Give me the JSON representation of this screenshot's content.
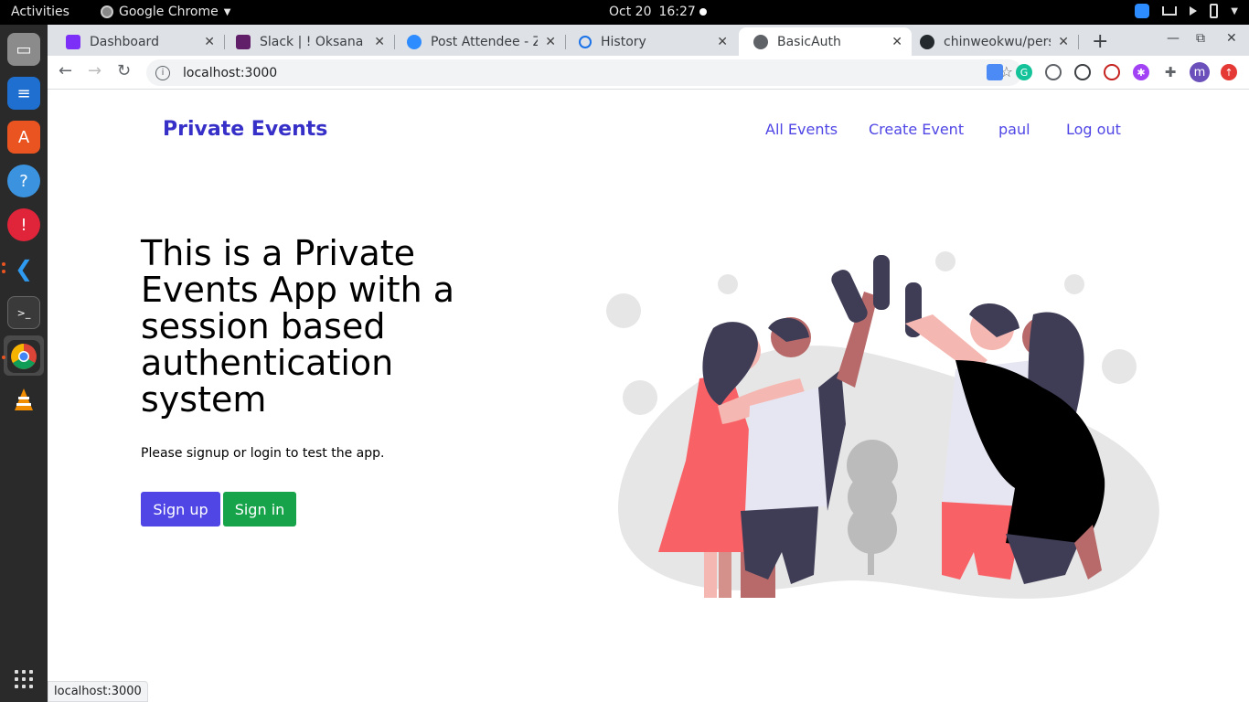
{
  "topbar": {
    "activities": "Activities",
    "app_name": "Google Chrome",
    "date": "Oct 20",
    "time": "16:27"
  },
  "browser": {
    "tabs": [
      {
        "label": "Dashboard",
        "icon": "dashboard-favicon",
        "color": "#7b2ff7"
      },
      {
        "label": "Slack | ! Oksana Pe",
        "icon": "slack-favicon",
        "color": "#611f69"
      },
      {
        "label": "Post Attendee - Zo",
        "icon": "zoom-favicon",
        "color": "#2d8cff"
      },
      {
        "label": "History",
        "icon": "history-icon",
        "color": "#1a73e8"
      },
      {
        "label": "BasicAuth",
        "icon": "globe-icon",
        "color": "#5f6368"
      },
      {
        "label": "chinweokwu/pers",
        "icon": "github-favicon",
        "color": "#24292e"
      }
    ],
    "active_tab_index": 4,
    "url": "localhost:3000",
    "profile_initial": "m",
    "status_url": "localhost:3000"
  },
  "site": {
    "brand": "Private Events",
    "nav": {
      "all_events": "All Events",
      "create_event": "Create Event",
      "user": "paul",
      "logout": "Log out"
    },
    "hero_title": "This is a Private Events App with a session based authentication system",
    "hero_subtitle": "Please signup or login to test the app.",
    "signup_label": "Sign up",
    "signin_label": "Sign in",
    "colors": {
      "brand": "#3730c8",
      "nav": "#4f46e5",
      "signup": "#4f46e5",
      "signin": "#16a34a"
    }
  }
}
